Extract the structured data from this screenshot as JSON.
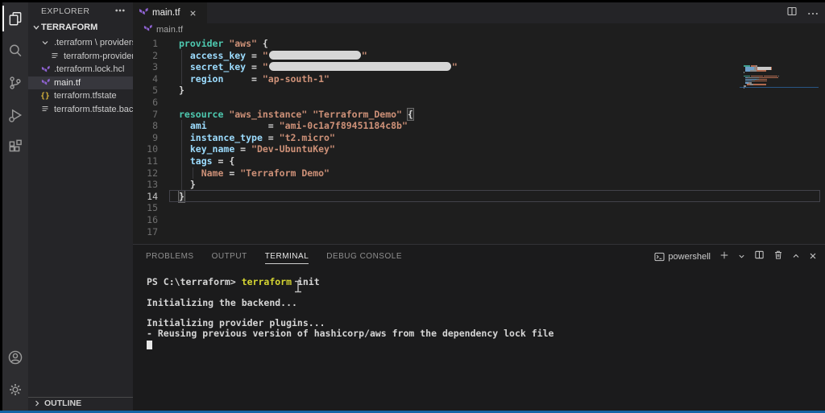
{
  "colors": {
    "terraform_purple": "#8f63d2",
    "statusbar_blue": "#1464a5",
    "keyword_teal": "#4ec9b0",
    "string_orange": "#ce9178",
    "property_blue": "#9cdcfe",
    "command_yellow": "#d6d632",
    "braces_yellow": "#d9b43c"
  },
  "activity_bar": {
    "items": [
      {
        "name": "explorer-icon",
        "active": true
      },
      {
        "name": "search-icon"
      },
      {
        "name": "source-control-icon"
      },
      {
        "name": "run-debug-icon"
      },
      {
        "name": "extensions-icon"
      }
    ],
    "bottom": [
      {
        "name": "account-icon"
      },
      {
        "name": "settings-gear-icon"
      }
    ]
  },
  "sidebar": {
    "header": "EXPLORER",
    "section": "TERRAFORM",
    "items": [
      {
        "label": ".terraform \\ providers...",
        "icon": "chevron-down-icon",
        "indent": 1
      },
      {
        "label": "terraform-provider-...",
        "icon": "file-icon",
        "indent": 2
      },
      {
        "label": ".terraform.lock.hcl",
        "icon": "terraform-icon",
        "indent": 1
      },
      {
        "label": "main.tf",
        "icon": "terraform-icon",
        "indent": 1,
        "selected": true
      },
      {
        "label": "terraform.tfstate",
        "icon": "braces-icon",
        "indent": 1
      },
      {
        "label": "terraform.tfstate.back...",
        "icon": "file-icon",
        "indent": 1
      }
    ],
    "outline": "OUTLINE"
  },
  "tab": {
    "label": "main.tf"
  },
  "breadcrumb": {
    "label": "main.tf"
  },
  "editor": {
    "lines": [
      {
        "num": 1,
        "tokens": [
          {
            "c": "kw",
            "t": "provider"
          },
          {
            "c": "pl",
            "t": " "
          },
          {
            "c": "str",
            "t": "\"aws\""
          },
          {
            "c": "pl",
            "t": " {"
          }
        ]
      },
      {
        "num": 2,
        "tokens": [
          {
            "c": "pl",
            "t": "  "
          },
          {
            "c": "prop",
            "t": "access_key"
          },
          {
            "c": "pl",
            "t": " = "
          },
          {
            "c": "str",
            "t": "\""
          },
          {
            "redact": 114,
            "name": "redacted-access-key"
          },
          {
            "c": "str",
            "t": "\""
          }
        ]
      },
      {
        "num": 3,
        "tokens": [
          {
            "c": "pl",
            "t": "  "
          },
          {
            "c": "prop",
            "t": "secret_key"
          },
          {
            "c": "pl",
            "t": " = "
          },
          {
            "c": "str",
            "t": "\""
          },
          {
            "redact": 226,
            "name": "redacted-secret-key"
          },
          {
            "c": "str",
            "t": "\""
          }
        ]
      },
      {
        "num": 4,
        "tokens": [
          {
            "c": "pl",
            "t": "  "
          },
          {
            "c": "prop",
            "t": "region"
          },
          {
            "c": "pl",
            "t": "     = "
          },
          {
            "c": "str",
            "t": "\"ap-south-1\""
          }
        ]
      },
      {
        "num": 5,
        "tokens": [
          {
            "c": "pl",
            "t": "}"
          }
        ]
      },
      {
        "num": 6,
        "tokens": []
      },
      {
        "num": 7,
        "tokens": [
          {
            "c": "kw",
            "t": "resource"
          },
          {
            "c": "pl",
            "t": " "
          },
          {
            "c": "str",
            "t": "\"aws_instance\""
          },
          {
            "c": "pl",
            "t": " "
          },
          {
            "c": "str",
            "t": "\"Terraform_Demo\""
          },
          {
            "c": "pl",
            "t": " "
          },
          {
            "c": "pl",
            "t": "{",
            "hl": true
          }
        ]
      },
      {
        "num": 8,
        "tokens": [
          {
            "c": "pl",
            "t": "  "
          },
          {
            "c": "prop",
            "t": "ami"
          },
          {
            "c": "pl",
            "t": "           = "
          },
          {
            "c": "str",
            "t": "\"ami-0c1a7f89451184c8b\""
          }
        ]
      },
      {
        "num": 9,
        "tokens": [
          {
            "c": "pl",
            "t": "  "
          },
          {
            "c": "prop",
            "t": "instance_type"
          },
          {
            "c": "pl",
            "t": " = "
          },
          {
            "c": "str",
            "t": "\"t2.micro\""
          }
        ]
      },
      {
        "num": 10,
        "tokens": [
          {
            "c": "pl",
            "t": "  "
          },
          {
            "c": "prop",
            "t": "key_name"
          },
          {
            "c": "pl",
            "t": " = "
          },
          {
            "c": "str",
            "t": "\"Dev-UbuntuKey\""
          }
        ]
      },
      {
        "num": 11,
        "tokens": [
          {
            "c": "pl",
            "t": "  "
          },
          {
            "c": "prop",
            "t": "tags"
          },
          {
            "c": "pl",
            "t": " = {"
          }
        ]
      },
      {
        "num": 12,
        "tokens": [
          {
            "c": "pl",
            "t": "    "
          },
          {
            "c": "str",
            "t": "Name"
          },
          {
            "c": "pl",
            "t": " = "
          },
          {
            "c": "str",
            "t": "\"Terraform Demo\""
          }
        ]
      },
      {
        "num": 13,
        "tokens": [
          {
            "c": "pl",
            "t": "  }"
          }
        ]
      },
      {
        "num": 14,
        "current": true,
        "tokens": [
          {
            "c": "pl",
            "t": "}",
            "hl": true
          }
        ]
      },
      {
        "num": 15,
        "tokens": []
      },
      {
        "num": 16,
        "tokens": []
      },
      {
        "num": 17,
        "tokens": []
      }
    ]
  },
  "panel": {
    "tabs": [
      "PROBLEMS",
      "OUTPUT",
      "TERMINAL",
      "DEBUG CONSOLE"
    ],
    "active_tab": "TERMINAL",
    "shell_label": "powershell",
    "terminal_lines": [
      [
        {
          "c": "pl",
          "t": "PS C:\\terraform> "
        },
        {
          "c": "cmd",
          "t": "terraform"
        },
        {
          "c": "pl",
          "t": " init"
        }
      ],
      [],
      [
        {
          "c": "pl",
          "t": "Initializing the backend..."
        }
      ],
      [],
      [
        {
          "c": "pl",
          "t": "Initializing provider plugins..."
        }
      ],
      [
        {
          "c": "pl",
          "t": "- Reusing previous version of hashicorp/aws from the dependency lock file"
        }
      ]
    ]
  }
}
